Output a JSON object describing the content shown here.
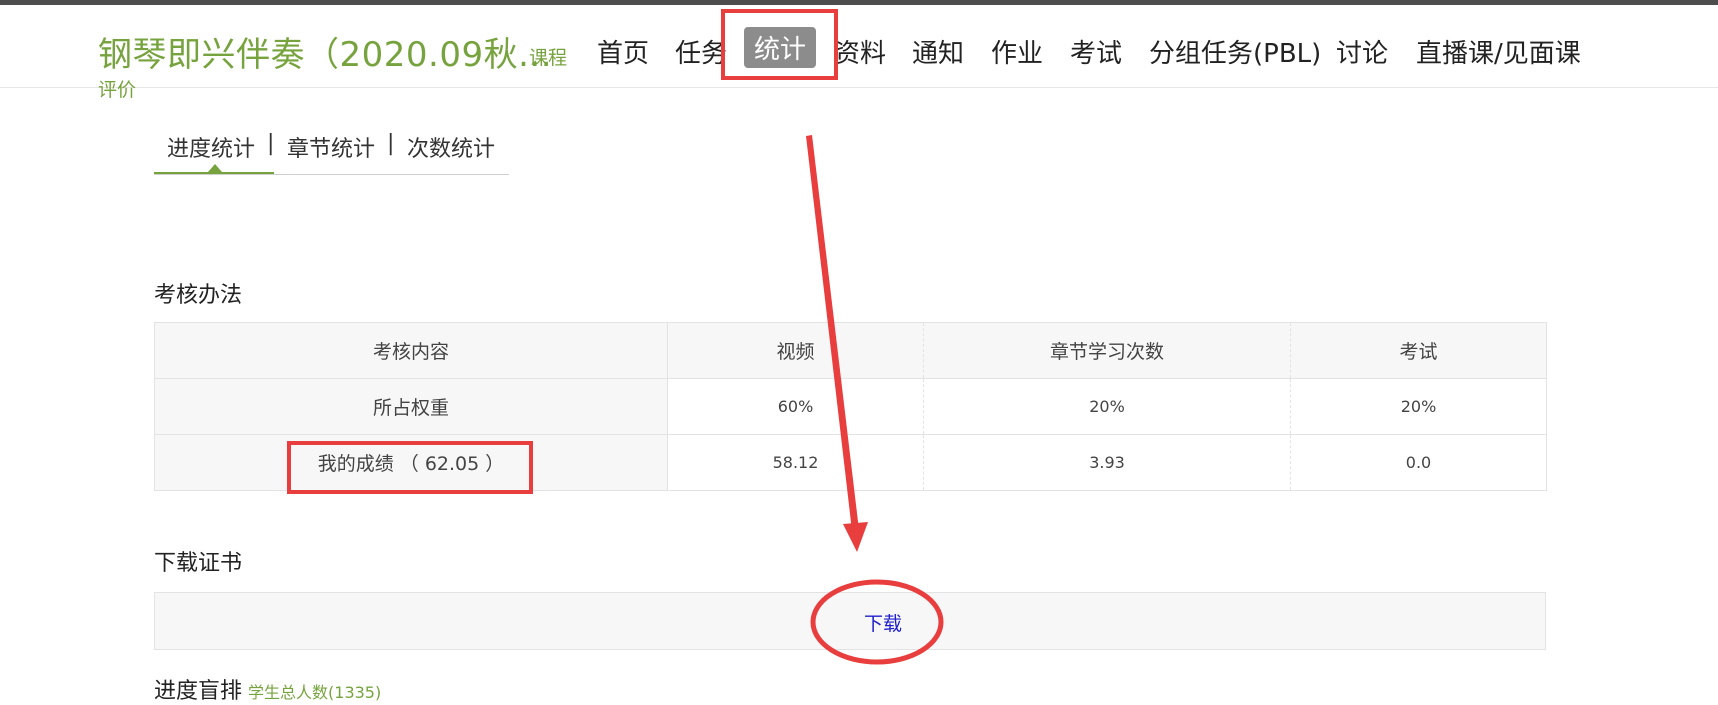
{
  "header": {
    "course_title": "钢琴即兴伴奏（2020.09秋...",
    "course_link": "课程",
    "eval_link": "评价",
    "nav": [
      {
        "label": "首页",
        "active": false
      },
      {
        "label": "任务",
        "active": false
      },
      {
        "label": "统计",
        "active": true
      },
      {
        "label": "资料",
        "active": false
      },
      {
        "label": "通知",
        "active": false
      },
      {
        "label": "作业",
        "active": false
      },
      {
        "label": "考试",
        "active": false
      },
      {
        "label": "分组任务(PBL)",
        "active": false
      },
      {
        "label": "讨论",
        "active": false
      },
      {
        "label": "直播课/见面课",
        "active": false
      }
    ]
  },
  "subtabs": {
    "items": [
      "进度统计",
      "章节统计",
      "次数统计"
    ],
    "separator": "|",
    "active_index": 0
  },
  "assessment": {
    "title": "考核办法",
    "columns": [
      "考核内容",
      "视频",
      "章节学习次数",
      "考试"
    ],
    "weight_row": {
      "label": "所占权重",
      "values": [
        "60%",
        "20%",
        "20%"
      ]
    },
    "score_row": {
      "label": "我的成绩 （ 62.05 ）",
      "values": [
        "58.12",
        "3.93",
        "0.0"
      ]
    }
  },
  "certificate": {
    "title": "下载证书",
    "download_label": "下载"
  },
  "ranking": {
    "title": "进度盲排",
    "student_count": "学生总人数(1335)"
  },
  "colors": {
    "accent": "#77a33e",
    "annotation": "#e83e3e",
    "link": "#1d1dcc",
    "active_nav_bg": "#8c8c8c"
  }
}
